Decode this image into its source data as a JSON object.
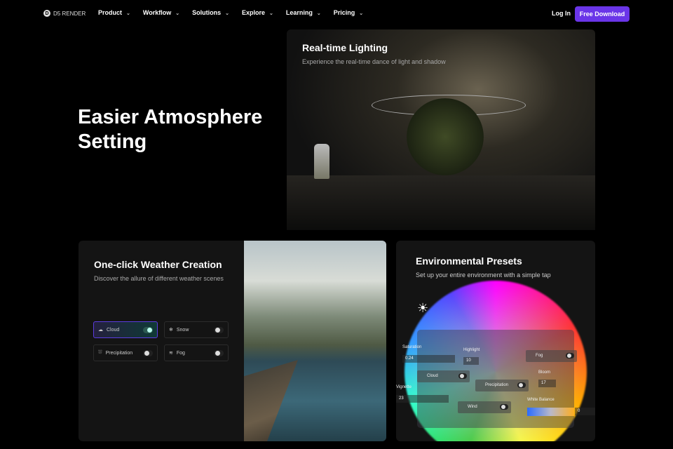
{
  "nav": {
    "logo": "D5 RENDER",
    "items": [
      "Product",
      "Workflow",
      "Solutions",
      "Explore",
      "Learning",
      "Pricing"
    ],
    "login": "Log In",
    "cta": "Free Download"
  },
  "hero": {
    "title": "Easier Atmosphere Setting"
  },
  "lighting": {
    "title": "Real-time Lighting",
    "subtitle": "Experience the real-time dance of light and shadow"
  },
  "weather": {
    "title": "One-click Weather Creation",
    "subtitle": "Discover the allure of different weather scenes",
    "options": [
      {
        "label": "Cloud",
        "icon": "cloud-icon",
        "on": true
      },
      {
        "label": "Snow",
        "icon": "snowflake-icon",
        "on": false
      },
      {
        "label": "Precipitation",
        "icon": "rain-icon",
        "on": false
      },
      {
        "label": "Fog",
        "icon": "fog-icon",
        "on": false
      }
    ]
  },
  "presets": {
    "title": "Environmental Presets",
    "subtitle": "Set up your entire environment with a simple tap",
    "saturation_label": "Saturation",
    "saturation": "0.24",
    "highlight_label": "Highlight",
    "highlight": "10",
    "fog": "Fog",
    "cloud": "Cloud",
    "bloom_label": "Bloom",
    "bloom": "17",
    "precipitation": "Precipitation",
    "vignette_label": "Vignette",
    "vignette": "23",
    "wind": "Wind",
    "wb_label": "White Balance",
    "wb": "0"
  },
  "colors": {
    "accent": "#6a35e8"
  }
}
